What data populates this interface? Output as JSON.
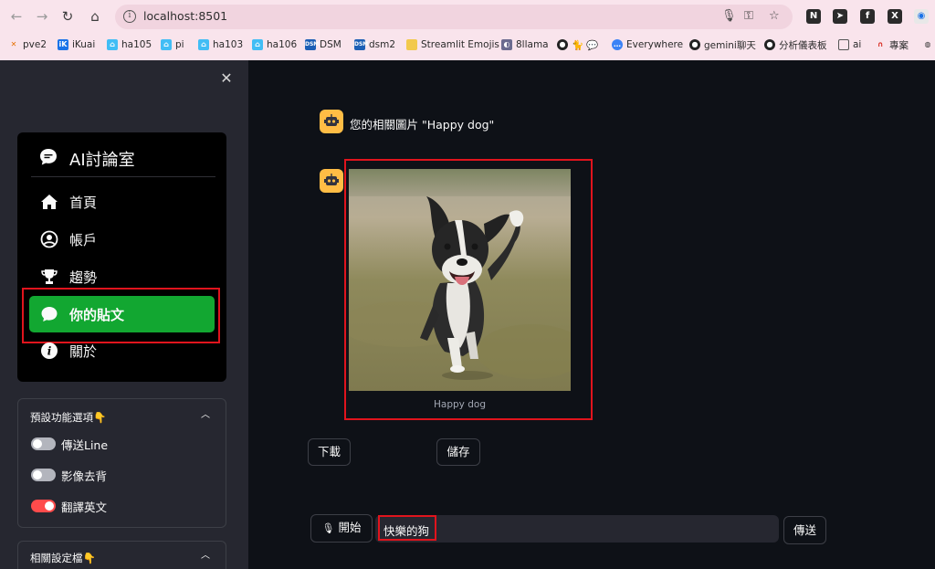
{
  "browser": {
    "url": "localhost:8501",
    "bookmarks": [
      {
        "label": "pve2",
        "icon": "proxmox-icon",
        "color": "#e57000"
      },
      {
        "label": "iKuai",
        "icon": "ikuai-icon",
        "color": "#1a73e8"
      },
      {
        "label": "ha105",
        "icon": "home-assistant-icon",
        "color": "#41bdf5"
      },
      {
        "label": "pi",
        "icon": "home-assistant-icon",
        "color": "#41bdf5"
      },
      {
        "label": "ha103",
        "icon": "home-assistant-icon",
        "color": "#41bdf5"
      },
      {
        "label": "ha106",
        "icon": "home-assistant-icon",
        "color": "#41bdf5"
      },
      {
        "label": "DSM",
        "icon": "dsm-icon",
        "color": "#1d5fb5"
      },
      {
        "label": "dsm2",
        "icon": "dsm-icon",
        "color": "#1d5fb5"
      },
      {
        "label": "Streamlit Emojis",
        "icon": "folder-icon",
        "color": "#f2c94c"
      },
      {
        "label": "8llama",
        "icon": "llama-icon",
        "color": "#6b6b8f"
      },
      {
        "label": "",
        "icon": "github-icon",
        "color": "#222222"
      },
      {
        "label": "Everywhere",
        "icon": "chat-icon",
        "color": "#3b82f6"
      },
      {
        "label": "gemini聊天",
        "icon": "github-icon",
        "color": "#222222"
      },
      {
        "label": "分析儀表板",
        "icon": "github-icon",
        "color": "#222222"
      },
      {
        "label": "ai",
        "icon": "folder-icon",
        "color": "#555555"
      },
      {
        "label": "專案",
        "icon": "arc-icon",
        "color": "#d93025"
      }
    ]
  },
  "sidebar": {
    "menu_title": "AI討論室",
    "items": [
      {
        "label": "首頁",
        "icon": "house-icon"
      },
      {
        "label": "帳戶",
        "icon": "person-circle-icon"
      },
      {
        "label": "趨勢",
        "icon": "trophy-icon"
      },
      {
        "label": "你的貼文",
        "icon": "chat-bubble-icon",
        "active": true
      },
      {
        "label": "關於",
        "icon": "info-icon"
      }
    ],
    "expander1": {
      "title": "預設功能選項👇",
      "toggles": [
        {
          "label": "傳送Line",
          "on": false
        },
        {
          "label": "影像去背",
          "on": false
        },
        {
          "label": "翻譯英文",
          "on": true
        }
      ]
    },
    "expander2": {
      "title": "相關設定檔👇"
    }
  },
  "chat": {
    "message": "您的相關圖片 \"Happy dog\"",
    "image_caption": "Happy dog",
    "download_label": "下載",
    "save_label": "儲存"
  },
  "input": {
    "mic_label": "開始",
    "value": "快樂的狗",
    "send_label": "傳送"
  },
  "colors": {
    "accent_green": "#12a731",
    "highlight_red": "#e0141d",
    "bot_avatar": "#ffbd45",
    "toggle_on": "#ff4b4b"
  }
}
